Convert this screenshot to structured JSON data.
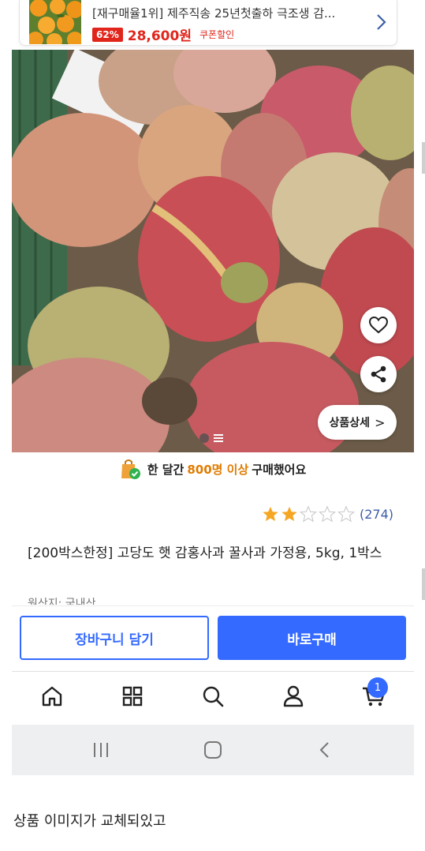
{
  "promo": {
    "title": "[재구매율1위] 제주직송 25년첫출하 극조생 감...",
    "discount": "62%",
    "price": "28,600원",
    "coupon": "쿠폰할인"
  },
  "image": {
    "detail_label": "상품상세",
    "detail_chevron": ">"
  },
  "purchase": {
    "prefix": "한 달간",
    "highlight": "800명 이상",
    "suffix": "구매했어요"
  },
  "rating": {
    "stars": 2,
    "max_stars": 5,
    "count": "(274)"
  },
  "product": {
    "title": "[200박스한정] 고당도 햇 감홍사과 꿀사과 가정용, 5kg, 1박스",
    "origin": "원산지: 국내산"
  },
  "actions": {
    "cart_label": "장바구니 담기",
    "buy_label": "바로구매"
  },
  "tabbar": {
    "cart_badge": "1"
  },
  "caption": "상품 이미지가 교체되있고",
  "colors": {
    "accent": "#346aff",
    "sale": "#e1251b",
    "highlight": "#e07b00",
    "star": "#f5a623"
  }
}
